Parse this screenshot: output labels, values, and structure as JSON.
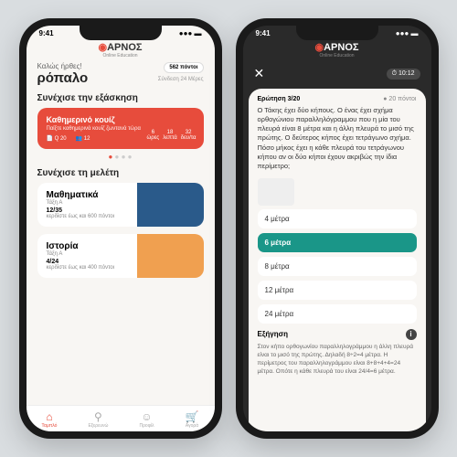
{
  "status_time": "9:41",
  "brand": {
    "name": "ΑΡΝΟΣ",
    "sub": "Online Education"
  },
  "home": {
    "greeting": "Καλώς ήρθες!",
    "username": "ρόπαλο",
    "points": "562 πόντοι",
    "streak": "Σύνδεση 24 Μέρες",
    "section1": "Συνέχισε την εξάσκηση",
    "quiz": {
      "title": "Καθημερινό κουίζ",
      "sub": "Παίξτε καθημερινά κουίζ ζωντανά τώρα",
      "q": "Q 20",
      "players": "12",
      "h": "6",
      "hl": "ώρες",
      "m": "18",
      "ml": "λεπτά",
      "s": "32",
      "sl": "δευ/τα"
    },
    "section2": "Συνέχισε τη μελέτη",
    "subjects": [
      {
        "name": "Μαθηματικά",
        "class": "Τάξη Α",
        "prog": "12/35",
        "pts": "κερδίστε έως και 600 πόντοι"
      },
      {
        "name": "Ιστορία",
        "class": "Τάξη Α",
        "prog": "4/24",
        "pts": "κερδίστε έως και 400 πόντοι"
      }
    ],
    "nav": [
      "Ταμπλό",
      "Εξερευνώ",
      "Προφίλ",
      "Αγορά"
    ]
  },
  "quiz": {
    "timer": "10:12",
    "qnum": "Ερώτηση 3/20",
    "qpts": "20 πόντοι",
    "qtext": "Ο Τάκης έχει δύο κήπους. Ο ένας έχει σχήμα ορθογώνιου παραλληλόγραμμου που η μία του πλευρά είναι 8 μέτρα και η άλλη πλευρά το μισό της πρώτης. Ο δεύτερος κήπος έχει τετράγωνο σχήμα. Πόσο μήκος έχει η κάθε πλευρά του τετράγωνου κήπου αν οι δύο κήποι έχουν ακριβώς την ίδια περίμετρο;",
    "answers": [
      "4 μέτρα",
      "6 μέτρα",
      "8 μέτρα",
      "12 μέτρα",
      "24 μέτρα"
    ],
    "selected": 1,
    "expl_head": "Εξήγηση",
    "expl": "Στον κήπο ορθογωνίου παραλληλογράμμου η άλλη πλευρά είναι το μισό της πρώτης. Δηλαδή 8÷2=4 μέτρα. Η περίμετρος του παραλληλογράμμου είναι 8+8+4+4=24 μέτρα. Οπότε η κάθε πλευρά του είναι 24/4=6 μέτρα."
  }
}
